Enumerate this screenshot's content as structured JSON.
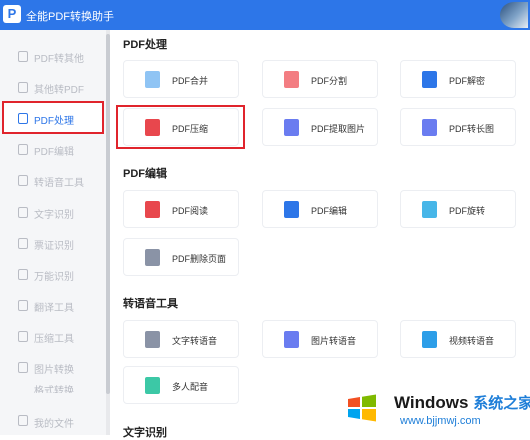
{
  "app": {
    "title": "全能PDF转换助手",
    "logo_letter": "P"
  },
  "sidebar": {
    "items": [
      {
        "label": "PDF转其他"
      },
      {
        "label": "其他转PDF"
      },
      {
        "label": "PDF处理"
      },
      {
        "label": "PDF编辑"
      },
      {
        "label": "转语音工具"
      },
      {
        "label": "文字识别"
      },
      {
        "label": "票证识别"
      },
      {
        "label": "万能识别"
      },
      {
        "label": "翻译工具"
      },
      {
        "label": "压缩工具"
      },
      {
        "label": "图片转换"
      },
      {
        "label": "格式转换"
      },
      {
        "label": "我的文件"
      }
    ]
  },
  "sections": [
    {
      "title": "PDF处理",
      "cards": [
        {
          "label": "PDF合并"
        },
        {
          "label": "PDF分割"
        },
        {
          "label": "PDF解密"
        },
        {
          "label": "PDF压缩"
        },
        {
          "label": "PDF提取图片"
        },
        {
          "label": "PDF转长图"
        }
      ]
    },
    {
      "title": "PDF编辑",
      "cards": [
        {
          "label": "PDF阅读"
        },
        {
          "label": "PDF编辑"
        },
        {
          "label": "PDF旋转"
        },
        {
          "label": "PDF删除页面"
        }
      ]
    },
    {
      "title": "转语音工具",
      "cards": [
        {
          "label": "文字转语音"
        },
        {
          "label": "图片转语音"
        },
        {
          "label": "视频转语音"
        },
        {
          "label": "多人配音"
        }
      ]
    },
    {
      "title": "文字识别",
      "cards": []
    }
  ],
  "watermark": {
    "brand": "Windows",
    "cn": "系统之家",
    "url": "www.bjjmwj.com"
  },
  "colors": {
    "accent": "#2d76e8",
    "highlight": "#e0242c"
  }
}
